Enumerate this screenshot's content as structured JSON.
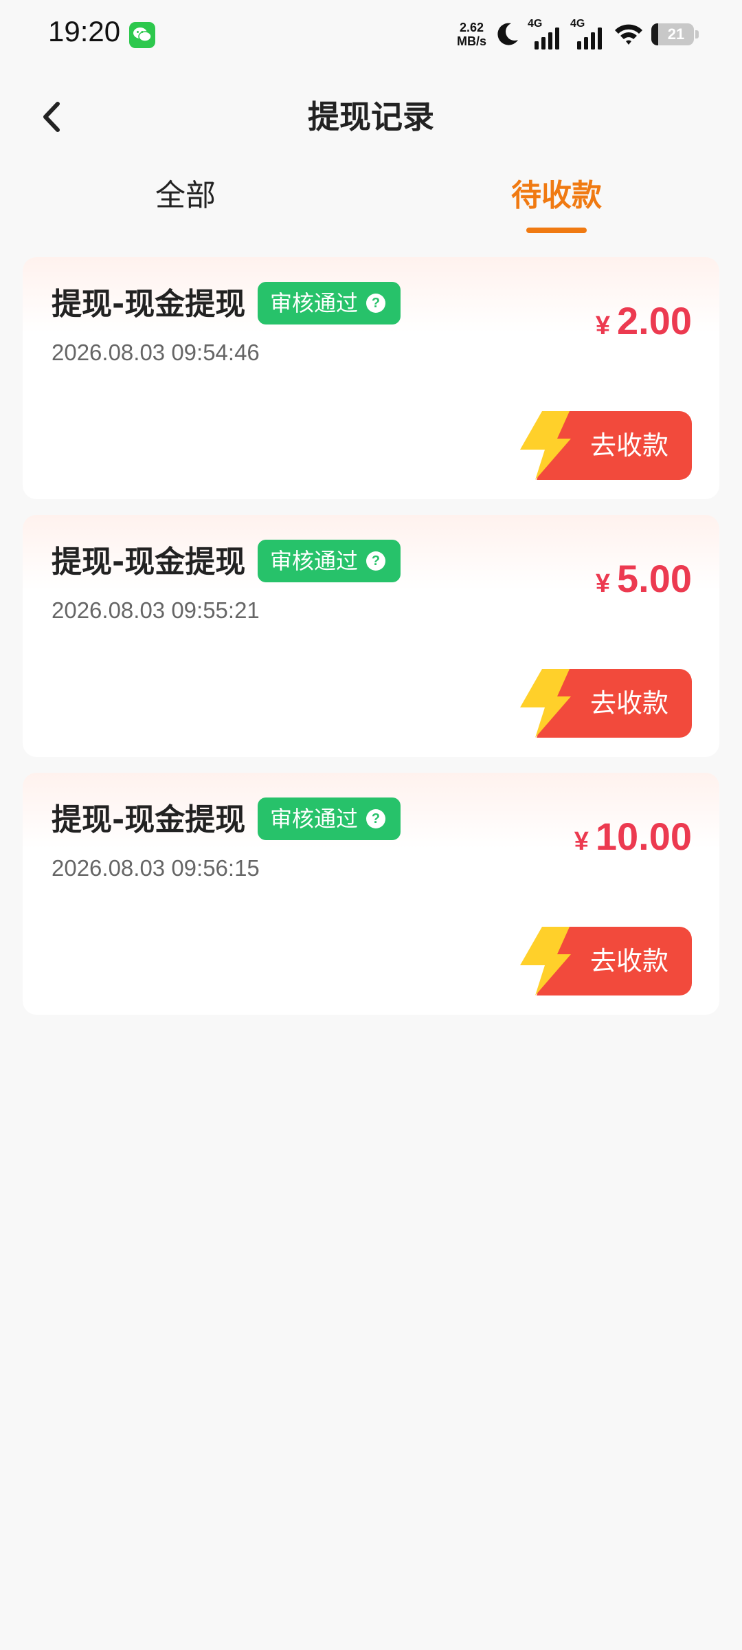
{
  "status_bar": {
    "time": "19:20",
    "net_speed_value": "2.62",
    "net_speed_unit": "MB/s",
    "signal1_label": "4G",
    "signal2_label": "4G",
    "battery": "21",
    "icons": [
      "wechat-icon",
      "moon-icon",
      "signal-icon",
      "signal-icon",
      "wifi-icon",
      "battery-icon"
    ]
  },
  "header": {
    "title": "提现记录",
    "back_icon": "chevron-left-icon"
  },
  "tabs": {
    "all": "全部",
    "pending": "待收款",
    "active": "pending",
    "active_color": "#f07a12"
  },
  "records": [
    {
      "title": "提现-现金提现",
      "status": "审核通过",
      "time": "2026.08.03 09:54:46",
      "currency": "¥",
      "amount": "2.00",
      "action": "去收款"
    },
    {
      "title": "提现-现金提现",
      "status": "审核通过",
      "time": "2026.08.03 09:55:21",
      "currency": "¥",
      "amount": "5.00",
      "action": "去收款"
    },
    {
      "title": "提现-现金提现",
      "status": "审核通过",
      "time": "2026.08.03 09:56:15",
      "currency": "¥",
      "amount": "10.00",
      "action": "去收款"
    }
  ],
  "colors": {
    "badge": "#27c26a",
    "amount": "#ec3a50",
    "button": "#f24a3c",
    "bolt": "#ffd02a"
  },
  "help_glyph": "?"
}
